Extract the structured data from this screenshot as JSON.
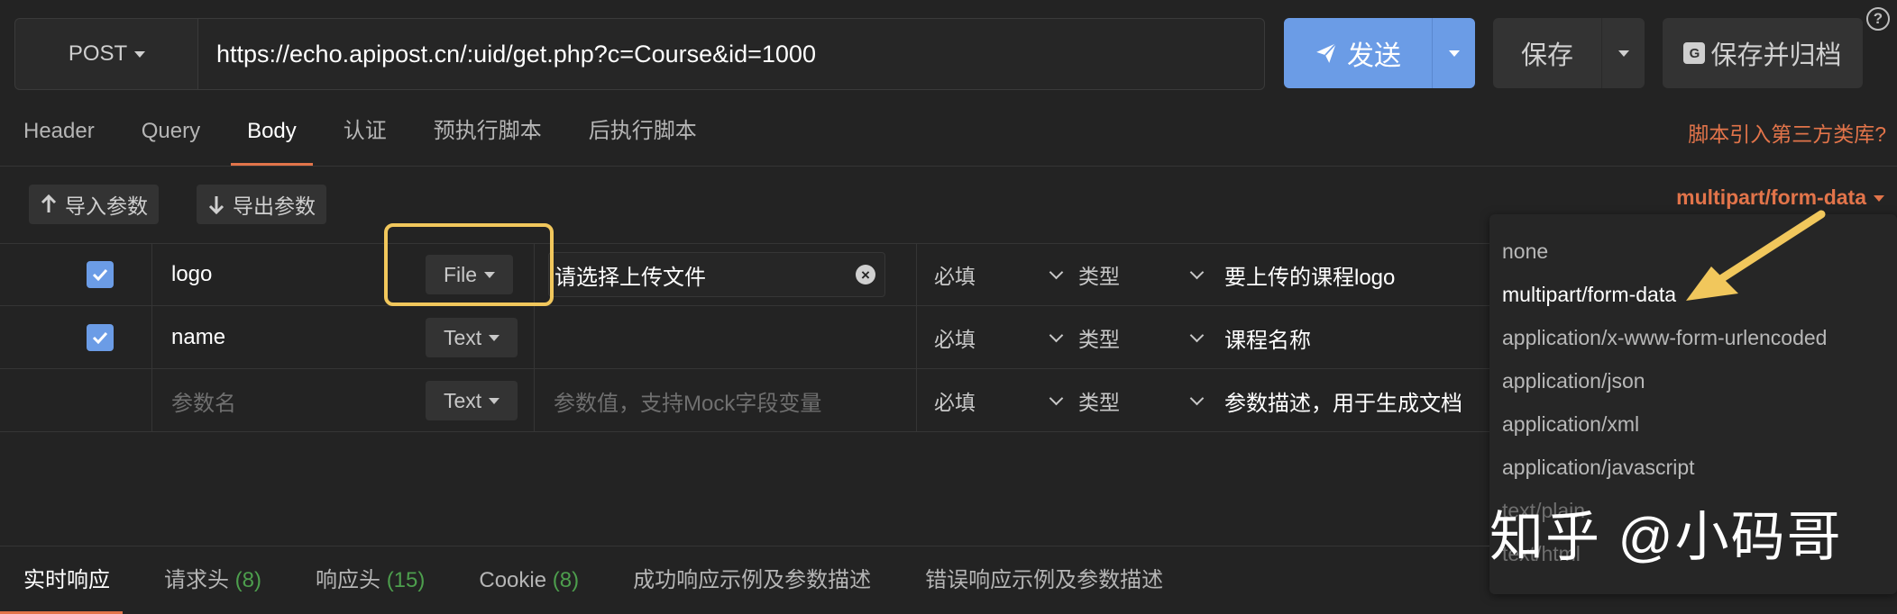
{
  "request": {
    "method": "POST",
    "url": "https://echo.apipost.cn/:uid/get.php?c=Course&id=1000",
    "send_label": "发送",
    "save_label": "保存",
    "archive_label": "保存并归档",
    "archive_badge": "G",
    "help": "?"
  },
  "tabs": [
    {
      "label": "Header"
    },
    {
      "label": "Query"
    },
    {
      "label": "Body"
    },
    {
      "label": "认证"
    },
    {
      "label": "预执行脚本"
    },
    {
      "label": "后执行脚本"
    }
  ],
  "active_tab": "Body",
  "script_link": "脚本引入第三方类库?",
  "toolbar": {
    "import_label": "导入参数",
    "export_label": "导出参数",
    "body_type": "multipart/form-data"
  },
  "params": [
    {
      "checked": true,
      "name": "logo",
      "type": "File",
      "value": "请选择上传文件",
      "required": "必填",
      "type_label": "类型",
      "description": "要上传的课程logo"
    },
    {
      "checked": true,
      "name": "name",
      "type": "Text",
      "value": "",
      "required": "必填",
      "type_label": "类型",
      "description": "课程名称"
    },
    {
      "checked": false,
      "name_placeholder": "参数名",
      "type": "Text",
      "value_placeholder": "参数值，支持Mock字段变量",
      "required": "必填",
      "type_label": "类型",
      "description_placeholder": "参数描述，用于生成文档"
    }
  ],
  "dropdown_options": [
    "none",
    "multipart/form-data",
    "application/x-www-form-urlencoded",
    "application/json",
    "application/xml",
    "application/javascript",
    "text/plain",
    "text/html"
  ],
  "watermark": "知乎 @小码哥",
  "response_tabs": [
    {
      "label": "实时响应",
      "count": ""
    },
    {
      "label": "请求头",
      "count": "(8)"
    },
    {
      "label": "响应头",
      "count": "(15)"
    },
    {
      "label": "Cookie",
      "count": "(8)"
    },
    {
      "label": "成功响应示例及参数描述",
      "count": ""
    },
    {
      "label": "错误响应示例及参数描述",
      "count": ""
    }
  ],
  "colors": {
    "accent": "#e2744a",
    "primary": "#6b9ce6",
    "highlight": "#f1c75c",
    "count_green": "#4d9e4d",
    "background": "#232323"
  }
}
